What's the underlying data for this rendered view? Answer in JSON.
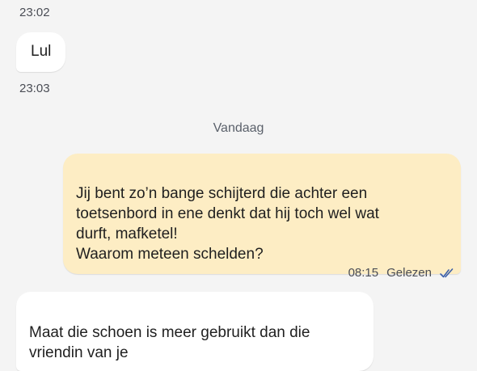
{
  "messages": [
    {
      "time": "23:02"
    },
    {
      "text": "Lul",
      "time": "23:03"
    }
  ],
  "day_separator": "Vandaag",
  "outgoing": {
    "text": "Jij bent zo’n bange schijterd die achter een\ntoetsenbord in ene denkt dat hij toch wel wat\ndurft, mafketel!\nWaarom meteen schelden?",
    "time": "08:15",
    "status": "Gelezen",
    "status_icon": "double-check-icon"
  },
  "incoming_last": {
    "text": "Maat die schoen is meer gebruikt dan die\nvriendin van je"
  },
  "colors": {
    "background": "#f4f4f4",
    "incoming_bubble": "#ffffff",
    "outgoing_bubble": "#fdedc4",
    "read_check": "#3b5fa8"
  }
}
